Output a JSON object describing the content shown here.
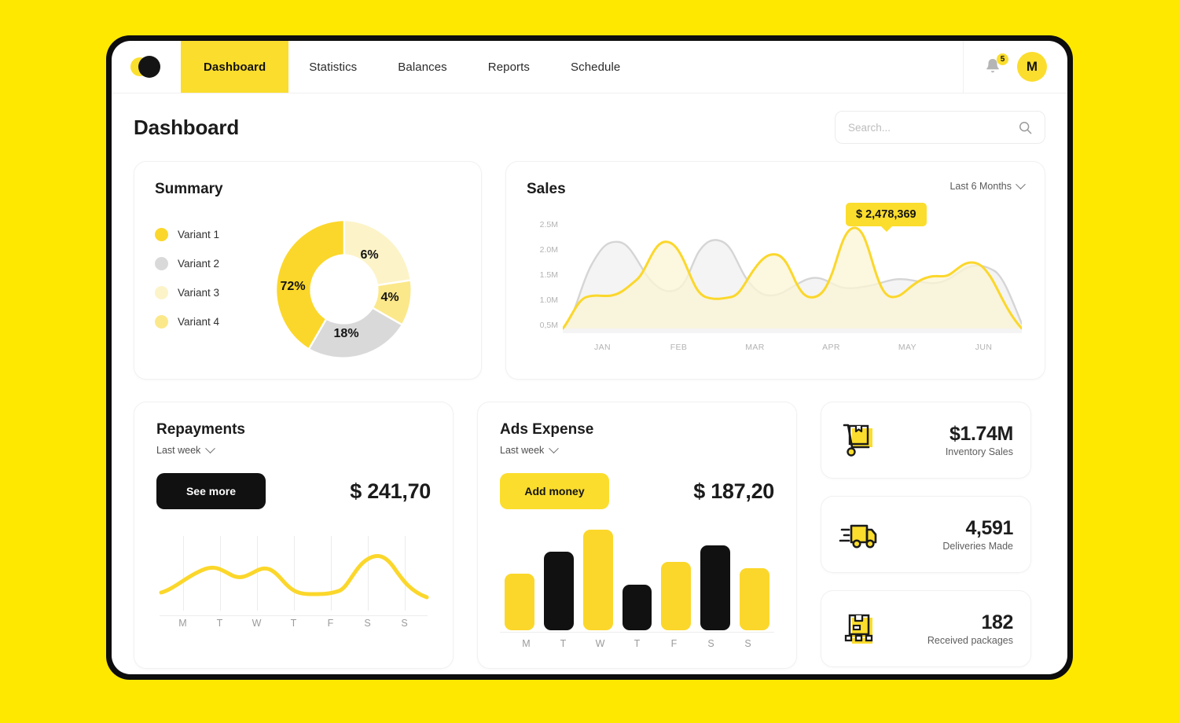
{
  "theme": {
    "background": "#FFE800",
    "accent": "#FBDD2D",
    "dark": "#111111",
    "gray": "#D9D9D9",
    "pale_yellow": "#FCF3C8",
    "light_yellow": "#FBE88A"
  },
  "nav": {
    "logo_icon": "eclipse-logo-icon",
    "items": [
      {
        "label": "Dashboard",
        "active": true
      },
      {
        "label": "Statistics",
        "active": false
      },
      {
        "label": "Balances",
        "active": false
      },
      {
        "label": "Reports",
        "active": false
      },
      {
        "label": "Schedule",
        "active": false
      }
    ],
    "notifications": {
      "icon": "bell-icon",
      "count": "5"
    },
    "avatar": {
      "initial": "M"
    }
  },
  "header": {
    "title": "Dashboard",
    "search": {
      "placeholder": "Search...",
      "value": "",
      "icon": "search-icon"
    }
  },
  "summary": {
    "title": "Summary",
    "legend": [
      {
        "label": "Variant 1",
        "color": "#FBD72B"
      },
      {
        "label": "Variant 2",
        "color": "#D9D9D9"
      },
      {
        "label": "Variant 3",
        "color": "#FCF3C8"
      },
      {
        "label": "Variant 4",
        "color": "#FBE88A"
      }
    ],
    "labels": {
      "p1": "72%",
      "p2": "18%",
      "p3": "6%",
      "p4": "4%"
    }
  },
  "sales": {
    "title": "Sales",
    "range_label": "Last 6 Months",
    "range_icon": "chevron-down-icon",
    "tooltip": "$ 2,478,369"
  },
  "repayments": {
    "title": "Repayments",
    "range_label": "Last week",
    "range_icon": "chevron-down-icon",
    "button_label": "See more",
    "amount": "$ 241,70"
  },
  "ads": {
    "title": "Ads Expense",
    "range_label": "Last week",
    "range_icon": "chevron-down-icon",
    "button_label": "Add money",
    "amount": "$ 187,20"
  },
  "stats": [
    {
      "icon": "hand-truck-icon",
      "value": "$1.74M",
      "label": "Inventory Sales"
    },
    {
      "icon": "delivery-truck-icon",
      "value": "4,591",
      "label": "Deliveries Made"
    },
    {
      "icon": "pallet-box-icon",
      "value": "182",
      "label": "Received packages"
    }
  ],
  "chart_data": [
    {
      "type": "pie",
      "title": "Summary",
      "categories": [
        "Variant 1",
        "Variant 2",
        "Variant 3",
        "Variant 4"
      ],
      "values": [
        72,
        18,
        6,
        4
      ],
      "labels": [
        "72%",
        "18%",
        "6%",
        "4%"
      ],
      "colors": [
        "#FBD72B",
        "#D9D9D9",
        "#FCF3C8",
        "#FBE88A"
      ],
      "donut": true,
      "legend_position": "left"
    },
    {
      "type": "area",
      "title": "Sales",
      "x": [
        "JAN",
        "FEB",
        "MAR",
        "APR",
        "MAY",
        "JUN"
      ],
      "ylabel": "",
      "xlabel": "",
      "ytick_labels": [
        "0,5M",
        "1.0M",
        "1.5M",
        "2.0M",
        "2.5M"
      ],
      "ytick_values": [
        0.5,
        1.0,
        1.5,
        2.0,
        2.5
      ],
      "ylim": [
        0.5,
        2.6
      ],
      "grid": false,
      "annotation": "$ 2,478,369",
      "annotation_x": "MAY",
      "annotation_y": 2.48,
      "series": [
        {
          "name": "Current",
          "color": "#FBD72B",
          "values": [
            0.5,
            1.05,
            1.1,
            1.25,
            1.9,
            1.55,
            0.82,
            0.8,
            1.1,
            1.78,
            1.5,
            0.92,
            1.05,
            2.48,
            1.6,
            0.8,
            1.0,
            1.38,
            1.25,
            0.5
          ]
        },
        {
          "name": "Previous",
          "color": "#D9D9D9",
          "values": [
            0.5,
            1.55,
            2.08,
            1.75,
            1.35,
            1.2,
            1.0,
            0.85,
            1.2,
            1.88,
            1.5,
            1.0,
            0.95,
            1.18,
            1.32,
            1.1,
            1.05,
            1.3,
            1.48,
            0.6
          ]
        }
      ]
    },
    {
      "type": "line",
      "title": "Repayments",
      "categories": [
        "M",
        "T",
        "W",
        "T",
        "F",
        "S",
        "S"
      ],
      "values": [
        28,
        62,
        52,
        60,
        24,
        22,
        74,
        34
      ],
      "ylim": [
        0,
        100
      ],
      "grid": true,
      "color": "#FBD72B"
    },
    {
      "type": "bar",
      "title": "Ads Expense",
      "categories": [
        "M",
        "T",
        "W",
        "T",
        "F",
        "S",
        "S"
      ],
      "values": [
        56,
        78,
        100,
        45,
        68,
        84,
        62
      ],
      "colors": [
        "#FBD72B",
        "#111111",
        "#FBD72B",
        "#111111",
        "#FBD72B",
        "#111111",
        "#FBD72B"
      ],
      "ylim": [
        0,
        100
      ]
    }
  ]
}
